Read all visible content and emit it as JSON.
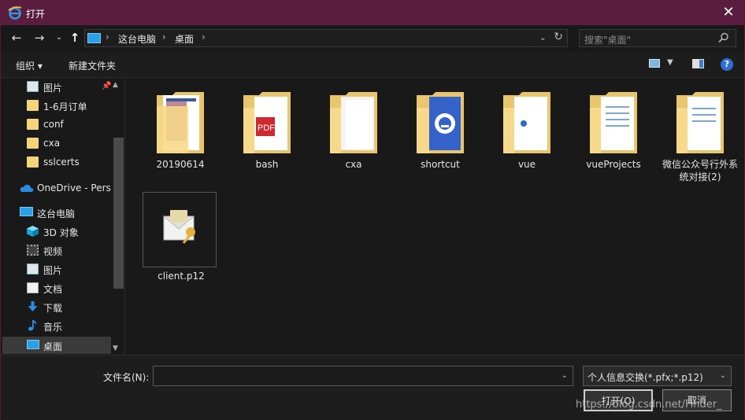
{
  "window": {
    "title": "打开"
  },
  "nav": {
    "breadcrumb": [
      "这台电脑",
      "桌面"
    ],
    "search_placeholder": "搜索\"桌面\""
  },
  "toolbar": {
    "organize": "组织 ▾",
    "new_folder": "新建文件夹"
  },
  "sidebar": {
    "items": [
      {
        "label": "图片",
        "icon": "pictures-icon"
      },
      {
        "label": "1-6月订单",
        "icon": "folder-icon"
      },
      {
        "label": "conf",
        "icon": "folder-icon"
      },
      {
        "label": "cxa",
        "icon": "folder-icon"
      },
      {
        "label": "sslcerts",
        "icon": "folder-icon"
      },
      {
        "label": "OneDrive - Perso",
        "icon": "onedrive-icon"
      },
      {
        "label": "这台电脑",
        "icon": "this-pc-icon"
      },
      {
        "label": "3D 对象",
        "icon": "3d-objects-icon"
      },
      {
        "label": "视频",
        "icon": "videos-icon"
      },
      {
        "label": "图片",
        "icon": "pictures-icon"
      },
      {
        "label": "文档",
        "icon": "documents-icon"
      },
      {
        "label": "下载",
        "icon": "downloads-icon"
      },
      {
        "label": "音乐",
        "icon": "music-icon"
      },
      {
        "label": "桌面",
        "icon": "desktop-icon"
      }
    ]
  },
  "files": [
    {
      "label": "20190614",
      "icon": "folder-with-docs-icon"
    },
    {
      "label": "bash",
      "icon": "folder-with-pdf-icon"
    },
    {
      "label": "cxa",
      "icon": "folder-icon"
    },
    {
      "label": "shortcut",
      "icon": "folder-with-app-icon"
    },
    {
      "label": "vue",
      "icon": "folder-with-file-icon"
    },
    {
      "label": "vueProjects",
      "icon": "folder-with-docs-icon"
    },
    {
      "label": "微信公众号行外系统对接(2)",
      "icon": "folder-with-docs-icon"
    },
    {
      "label": "client.p12",
      "icon": "certificate-icon"
    }
  ],
  "bottom": {
    "filename_label": "文件名(N):",
    "filename_value": "",
    "filetype": "个人信息交换(*.pfx;*.p12)",
    "open_button": "打开(O)",
    "cancel_button": "取消"
  },
  "watermark": "https://blog.csdn.net/Finder_"
}
